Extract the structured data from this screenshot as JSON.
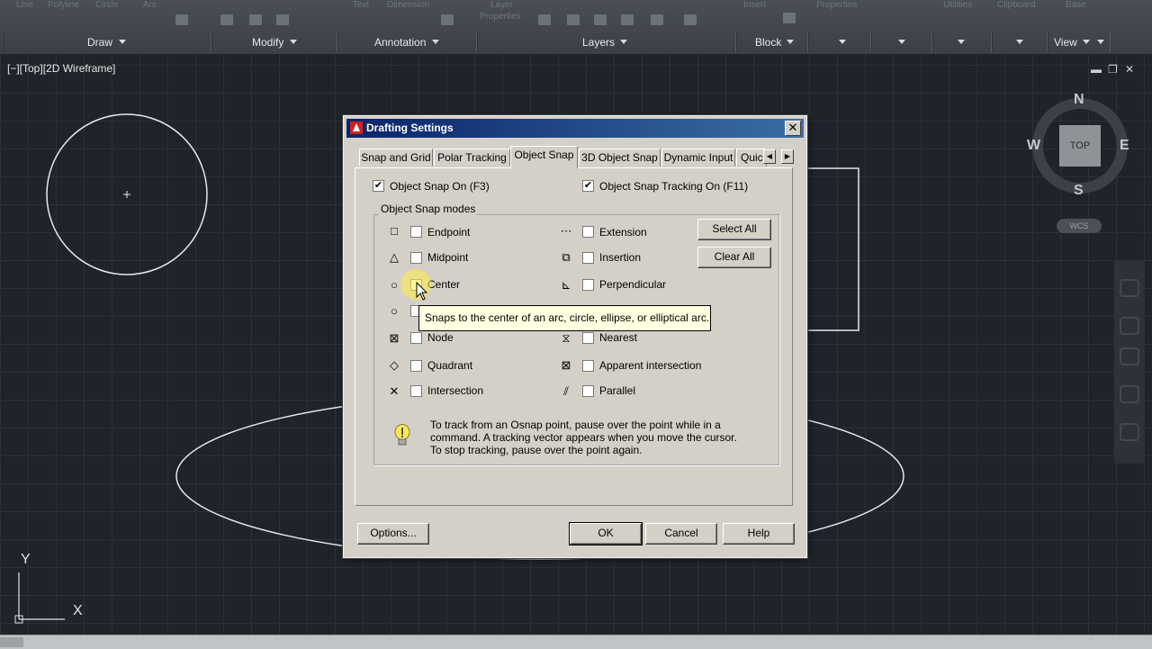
{
  "ribbon": {
    "top_labels": [
      "Line",
      "Polyline",
      "Circle",
      "Arc",
      "Text",
      "Dimension",
      "Layer",
      "Properties",
      "Insert",
      "Properties",
      "Utilities",
      "Clipboard",
      "Base"
    ],
    "panels": [
      "Draw",
      "Modify",
      "Annotation",
      "Layers",
      "Block",
      "View"
    ]
  },
  "viewport": {
    "label": "[−][Top][2D Wireframe]",
    "ctrl_min": "▬",
    "ctrl_restore": "❐",
    "ctrl_close": "✕"
  },
  "viewcube": {
    "north": "N",
    "south": "S",
    "east": "E",
    "west": "W",
    "top": "TOP",
    "wcs": "WCS"
  },
  "ucs": {
    "x": "X",
    "y": "Y"
  },
  "dialog": {
    "title": "Drafting Settings",
    "close": "✕",
    "tabs": [
      "Snap and Grid",
      "Polar Tracking",
      "Object Snap",
      "3D Object Snap",
      "Dynamic Input",
      "Quic"
    ],
    "active_tab": "Object Snap",
    "tab_scroll_left": "◀",
    "tab_scroll_right": "▶",
    "osnap_on": {
      "label": "Object Snap On (F3)",
      "checked": true,
      "mark": "✔"
    },
    "osnap_tracking": {
      "label": "Object Snap Tracking On (F11)",
      "checked": true,
      "mark": "✔"
    },
    "group_title": "Object Snap modes",
    "modes_left": [
      {
        "label": "Endpoint",
        "symbol": "□"
      },
      {
        "label": "Midpoint",
        "symbol": "△"
      },
      {
        "label": "Center",
        "symbol": "○"
      },
      {
        "label": "",
        "symbol": "○"
      },
      {
        "label": "Node",
        "symbol": "⊠"
      },
      {
        "label": "Quadrant",
        "symbol": "◇"
      },
      {
        "label": "Intersection",
        "symbol": "✕"
      }
    ],
    "modes_right": [
      {
        "label": "Extension",
        "symbol": "⋯"
      },
      {
        "label": "Insertion",
        "symbol": "⧉"
      },
      {
        "label": "Perpendicular",
        "symbol": "⊾"
      },
      {
        "label": "",
        "symbol": ""
      },
      {
        "label": "Nearest",
        "symbol": "⧖"
      },
      {
        "label": "Apparent intersection",
        "symbol": "⊠"
      },
      {
        "label": "Parallel",
        "symbol": "⫽"
      }
    ],
    "select_all": "Select All",
    "clear_all": "Clear All",
    "tip_line1": "To track from an Osnap point, pause over the point while in a",
    "tip_line2": "command.  A tracking vector appears when you move the cursor.",
    "tip_line3": "To stop tracking, pause over the point again.",
    "tooltip": "Snaps to the center of an arc, circle, ellipse, or elliptical arc.",
    "options": "Options...",
    "ok": "OK",
    "cancel": "Cancel",
    "help": "Help"
  }
}
